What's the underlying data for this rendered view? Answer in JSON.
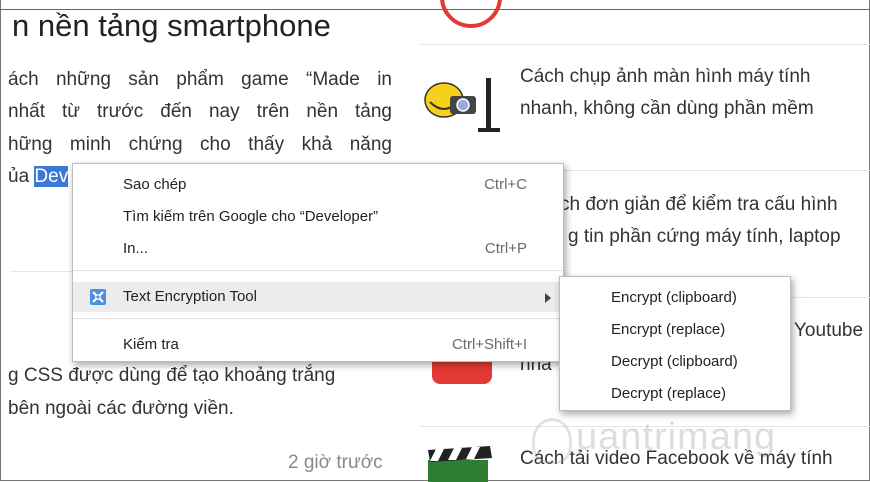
{
  "article": {
    "title": "n nền tảng smartphone",
    "lines": [
      "ách những sản phẩm game “Made in",
      " nhất từ trước đến nay trên nền tảng",
      "hững minh chứng cho thấy khả năng"
    ],
    "line4_prefix": "ủa ",
    "line4_highlight": "Dev",
    "lower_lines": [
      "g CSS được dùng để tạo khoảng trắng",
      "bên ngoài các đường viền."
    ],
    "time_ago": "2 giờ trước"
  },
  "news": [
    {
      "line1": "Cách chụp ảnh màn hình máy tính",
      "line2": "nhanh, không cần dùng phần mềm",
      "icon": "camera-computer-icon"
    },
    {
      "line1": "ch đơn giản để kiểm tra cấu hình",
      "line2": "g tin phần cứng máy tính, laptop",
      "icon": ""
    },
    {
      "line1": "Youtube",
      "line2": "nha",
      "icon": "youtube-icon"
    },
    {
      "line1": "Cách tải video Facebook về máy tính",
      "line2": "",
      "icon": "clapperboard-icon"
    }
  ],
  "context_menu": {
    "items": [
      {
        "label": "Sao chép",
        "shortcut": "Ctrl+C"
      },
      {
        "label": "Tìm kiếm trên Google cho “Developer”",
        "shortcut": ""
      },
      {
        "label": "In...",
        "shortcut": "Ctrl+P"
      },
      {
        "label": "Text Encryption Tool",
        "shortcut": ""
      },
      {
        "label": "Kiểm tra",
        "shortcut": "Ctrl+Shift+I"
      }
    ]
  },
  "submenu": {
    "items": [
      {
        "label": "Encrypt (clipboard)"
      },
      {
        "label": "Encrypt (replace)"
      },
      {
        "label": "Decrypt (clipboard)"
      },
      {
        "label": "Decrypt (replace)"
      }
    ]
  },
  "watermark": {
    "text": "uantrimang"
  },
  "colors": {
    "selection": "#3b79d6",
    "youtube": "#e53935"
  }
}
